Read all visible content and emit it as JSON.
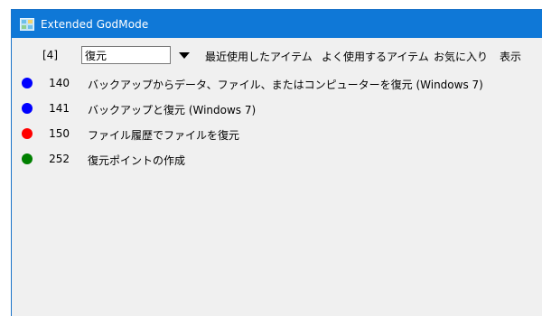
{
  "window": {
    "title": "Extended GodMode"
  },
  "toolbar": {
    "count": "[4]",
    "search_value": "復元",
    "menu": {
      "recent": "最近使用したアイテム",
      "frequent": "よく使用するアイテム",
      "favorites": "お気に入り",
      "view": "表示"
    }
  },
  "colors": {
    "titlebar": "#0f78d7",
    "blue_dot": "#0000ff",
    "red_dot": "#ff0000",
    "green_dot": "#008000"
  },
  "items": [
    {
      "color": "#0000ff",
      "id": "140",
      "label": "バックアップからデータ、ファイル、またはコンピューターを復元 (Windows 7)"
    },
    {
      "color": "#0000ff",
      "id": "141",
      "label": "バックアップと復元 (Windows 7)"
    },
    {
      "color": "#ff0000",
      "id": "150",
      "label": "ファイル履歴でファイルを復元"
    },
    {
      "color": "#008000",
      "id": "252",
      "label": "復元ポイントの作成"
    }
  ]
}
